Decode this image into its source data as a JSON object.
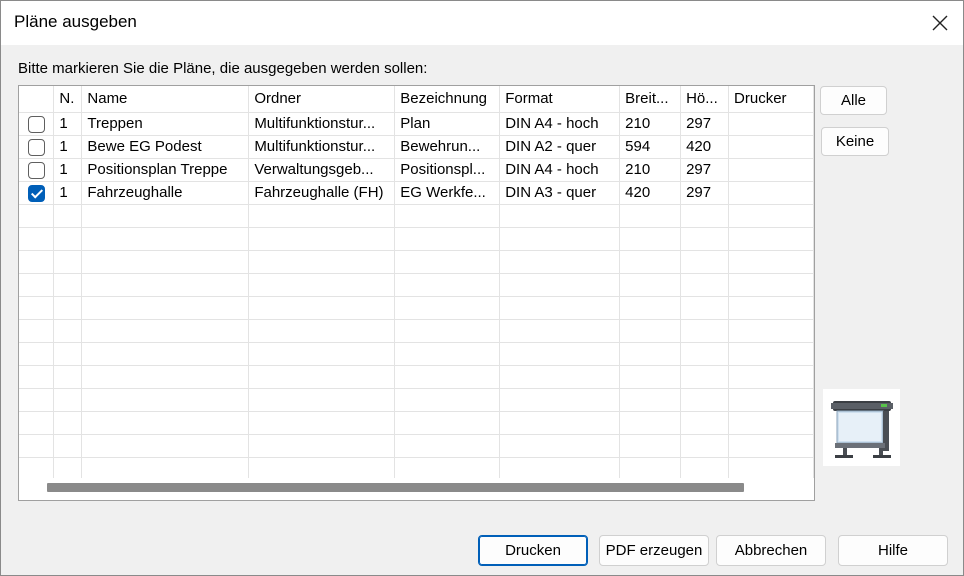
{
  "window": {
    "title": "Pläne ausgeben"
  },
  "instruction": "Bitte markieren Sie die Pläne, die ausgegeben werden sollen:",
  "grid": {
    "columns": [
      "",
      "N.",
      "Name",
      "Ordner",
      "Bezeichnung",
      "Format",
      "Breit...",
      "Hö...",
      "Drucker"
    ],
    "rows": [
      {
        "checked": false,
        "n": "1",
        "name": "Treppen",
        "ordner": "Multifunktionstur...",
        "bezeichnung": "Plan",
        "format": "DIN A4 - hoch",
        "breite": "210",
        "hoehe": "297",
        "drucker": ""
      },
      {
        "checked": false,
        "n": "1",
        "name": "Bewe EG Podest",
        "ordner": "Multifunktionstur...",
        "bezeichnung": "Bewehrun...",
        "format": "DIN A2 - quer",
        "breite": "594",
        "hoehe": "420",
        "drucker": ""
      },
      {
        "checked": false,
        "n": "1",
        "name": "Positionsplan Treppe",
        "ordner": "Verwaltungsgeb...",
        "bezeichnung": "Positionspl...",
        "format": "DIN A4 - hoch",
        "breite": "210",
        "hoehe": "297",
        "drucker": ""
      },
      {
        "checked": true,
        "n": "1",
        "name": "Fahrzeughalle",
        "ordner": "Fahrzeughalle (FH)",
        "bezeichnung": "EG Werkfe...",
        "format": "DIN A3 - quer",
        "breite": "420",
        "hoehe": "297",
        "drucker": ""
      }
    ],
    "empty_rows": 12
  },
  "side_buttons": {
    "all": "Alle",
    "none": "Keine"
  },
  "buttons": {
    "print": "Drucken",
    "pdf": "PDF erzeugen",
    "cancel": "Abbrechen",
    "help": "Hilfe"
  },
  "icons": {
    "close": "close-icon",
    "printer": "plotter-printer-icon"
  },
  "colors": {
    "accent": "#005fb8",
    "background": "#f0f0f0"
  }
}
